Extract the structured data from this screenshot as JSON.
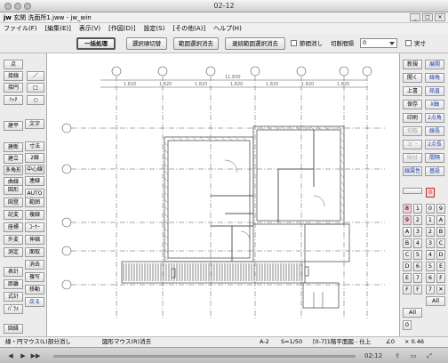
{
  "mac_window": {
    "title": "02-12"
  },
  "app_window": {
    "app_name": "jw",
    "title_rest": " 玄関 洗面所1.jww - jw_win",
    "buttons": [
      "_",
      "□",
      "×"
    ]
  },
  "menu": [
    "ファイル(F)",
    "[編集(E)]",
    "表示(V)",
    "[作図(D)]",
    "設定(S)",
    "[その他(A)]",
    "ヘルプ(H)"
  ],
  "toolbar": {
    "batch_process": "一括処理",
    "select_all": "選択順切替",
    "clear_range": "範囲選択消去",
    "clear_continuous": "連続範囲選択消去",
    "clear_node": "節間消し",
    "cut_interval_label": "切断間隔",
    "cut_interval_value": "0",
    "real_size": "実寸"
  },
  "left_tools": [
    {
      "label": "点",
      "color": "#000000"
    },
    {
      "label": "接線",
      "color": "#000000"
    },
    {
      "label": "接円",
      "color": "#000000"
    },
    {
      "label": "ﾊｯﾁ",
      "color": "#000000"
    },
    {
      "label": "／",
      "color": "#000000"
    },
    {
      "label": "□",
      "color": "#000000"
    },
    {
      "label": "○",
      "color": "#000000"
    },
    {
      "label": "建平",
      "color": "#000000"
    },
    {
      "label": "文字",
      "color": "#000000"
    },
    {
      "label": "建断",
      "color": "#000000"
    },
    {
      "label": "寸法",
      "color": "#000000"
    },
    {
      "label": "建立",
      "color": "#000000"
    },
    {
      "label": "2線",
      "color": "#000000"
    },
    {
      "label": "多角形",
      "color": "#000000"
    },
    {
      "label": "中心線",
      "color": "#000000"
    },
    {
      "label": "曲線",
      "color": "#000000"
    },
    {
      "label": "連線",
      "color": "#000000"
    },
    {
      "label": "AUTO",
      "color": "#000000"
    },
    {
      "label": "図形",
      "color": "#000000"
    },
    {
      "label": "範囲",
      "color": "#000000"
    },
    {
      "label": "図登",
      "color": "#000000"
    },
    {
      "label": "複線",
      "color": "#000000"
    },
    {
      "label": "記変",
      "color": "#000000"
    },
    {
      "label": "ｺｰﾅｰ",
      "color": "#000000"
    },
    {
      "label": "座標",
      "color": "#000000"
    },
    {
      "label": "伸縮",
      "color": "#000000"
    },
    {
      "label": "外変",
      "color": "#000000"
    },
    {
      "label": "面取",
      "color": "#000000"
    },
    {
      "label": "測定",
      "color": "#000000"
    },
    {
      "label": "消去",
      "color": "#000000"
    },
    {
      "label": "表計",
      "color": "#000000"
    },
    {
      "label": "複写",
      "color": "#000000"
    },
    {
      "label": "距離",
      "color": "#000000"
    },
    {
      "label": "移動",
      "color": "#000000"
    },
    {
      "label": "式計",
      "color": "#000000"
    },
    {
      "label": "戻る",
      "color": "#1a3ea8"
    },
    {
      "label": "ﾊﾟﾗﾒ",
      "color": "#000000"
    },
    {
      "label": "図縁",
      "color": "#000000"
    }
  ],
  "right_tools": [
    {
      "label": "新規",
      "color": "#000000"
    },
    {
      "label": "展開",
      "color": "#1a3ea8"
    },
    {
      "label": "開く",
      "color": "#000000"
    },
    {
      "label": "線角",
      "color": "#1a3ea8"
    },
    {
      "label": "上書",
      "color": "#000000"
    },
    {
      "label": "鉛直",
      "color": "#1a3ea8"
    },
    {
      "label": "保存",
      "color": "#000000"
    },
    {
      "label": "X軸",
      "color": "#1a3ea8"
    },
    {
      "label": "印刷",
      "color": "#000000"
    },
    {
      "label": "2点角",
      "color": "#1a3ea8"
    },
    {
      "label": "切取",
      "color": "#a0a0a0"
    },
    {
      "label": "線長",
      "color": "#1a3ea8"
    },
    {
      "label": "ｺﾋﾟｰ",
      "color": "#a0a0a0"
    },
    {
      "label": "2点長",
      "color": "#1a3ea8"
    },
    {
      "label": "貼付",
      "color": "#a0a0a0"
    },
    {
      "label": "間隔",
      "color": "#1a3ea8"
    },
    {
      "label": "線属性",
      "color": "#1a3ea8"
    },
    {
      "label": "基設",
      "color": "#1a3ea8"
    }
  ],
  "layers": {
    "layer_group_labels": [
      "0",
      "1",
      "2",
      "3",
      "4",
      "5",
      "6",
      "7"
    ],
    "selected_group": "0",
    "layers_a": [
      "8",
      "9",
      "A",
      "B",
      "C",
      "D",
      "E",
      "F"
    ],
    "layers_b": [
      "1",
      "2",
      "3",
      "4",
      "5",
      "6",
      "7",
      "F"
    ],
    "all_label": "All",
    "all_label2": "All",
    "zero_label": "0"
  },
  "canvas": {
    "grid_labels_top": [
      "1.820",
      "1.820",
      "1.820",
      "1.820",
      "1.820",
      "1.820",
      "1.820",
      "11.830"
    ],
    "background": "#ffffff",
    "line_color": "#555555"
  },
  "status": {
    "left_hint": "線・円マウス(L)部分消し",
    "right_hint": "図形マウス(R)消去",
    "paper": "A-2",
    "scale": "S=1/50",
    "layer_name": "[0-7]1階平面図 - 仕上",
    "angle": "∠0",
    "zoom": "× 0.46"
  },
  "player": {
    "time": "02:12"
  }
}
